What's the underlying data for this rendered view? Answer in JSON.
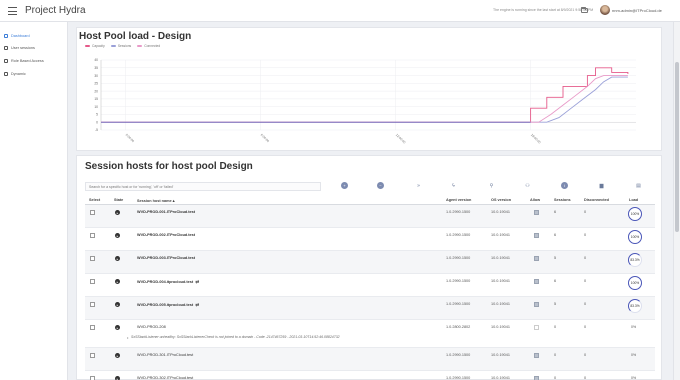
{
  "app": {
    "title": "Project Hydra"
  },
  "topbar": {
    "notice": "The engine is running since the last start at 8/9/2021 9:58:58 PM",
    "user_email": "nnm-admin@ITProCloud.de"
  },
  "sidebar": {
    "items": [
      {
        "label": "Dashboard",
        "icon": "dashboard-icon",
        "active": true
      },
      {
        "label": "User sessions",
        "icon": "users-icon",
        "active": false
      },
      {
        "label": "Role Based Access",
        "icon": "lock-icon",
        "active": false
      },
      {
        "label": "Dynamic",
        "icon": "dynamic-icon",
        "active": false
      }
    ]
  },
  "chart_section": {
    "title": "Host Pool load - Design",
    "legend": [
      {
        "name": "Capacity",
        "color": "#e55a8a"
      },
      {
        "name": "Sessions",
        "color": "#9aa0d8"
      },
      {
        "name": "Connected",
        "color": "#e89ac8"
      }
    ]
  },
  "chart_data": {
    "type": "line",
    "title": "Host Pool load - Design",
    "xlabel": "",
    "ylabel": "",
    "ylim": [
      -5,
      40
    ],
    "yticks": [
      -5,
      0,
      5,
      10,
      15,
      20,
      25,
      30,
      35,
      40
    ],
    "xticks": [
      "0:00:00",
      "6:00:00",
      "12:00:00",
      "18:00:00"
    ],
    "grid": true,
    "series": [
      {
        "name": "Capacity",
        "color": "#e55a8a",
        "points": [
          [
            -0.06,
            0
          ],
          [
            1.0,
            0
          ],
          [
            1.0,
            9
          ],
          [
            1.04,
            9
          ],
          [
            1.04,
            16
          ],
          [
            1.08,
            16
          ],
          [
            1.08,
            23
          ],
          [
            1.14,
            23
          ],
          [
            1.14,
            30
          ],
          [
            1.16,
            30
          ],
          [
            1.16,
            35
          ],
          [
            1.2,
            35
          ],
          [
            1.2,
            32
          ],
          [
            1.24,
            32
          ],
          [
            1.24,
            31
          ]
        ]
      },
      {
        "name": "Sessions",
        "color": "#9aa0d8",
        "points": [
          [
            -0.06,
            0
          ],
          [
            1.04,
            0
          ],
          [
            1.07,
            3
          ],
          [
            1.1,
            9
          ],
          [
            1.13,
            15
          ],
          [
            1.16,
            21
          ],
          [
            1.18,
            26
          ],
          [
            1.2,
            29
          ],
          [
            1.24,
            29
          ]
        ]
      },
      {
        "name": "Connected",
        "color": "#e89ac8",
        "points": [
          [
            -0.06,
            0
          ],
          [
            1.02,
            0
          ],
          [
            1.05,
            5
          ],
          [
            1.08,
            11
          ],
          [
            1.11,
            17
          ],
          [
            1.14,
            23
          ],
          [
            1.16,
            28
          ],
          [
            1.18,
            30
          ],
          [
            1.24,
            30
          ]
        ]
      }
    ],
    "x_domain": [
      -0.06,
      1.26
    ]
  },
  "hosts_section": {
    "title": "Session hosts for host pool Design",
    "search_placeholder": "Search for a specific host or for 'running', 'off' or 'failed'",
    "actions": [
      {
        "name": "add-host-action",
        "glyph": "+",
        "circle": true
      },
      {
        "name": "remove-host-action",
        "glyph": "−",
        "circle": true
      },
      {
        "name": "forward-action",
        "glyph": "»",
        "circle": false
      },
      {
        "name": "power-action",
        "glyph": "ϟ",
        "circle": false
      },
      {
        "name": "attach-action",
        "glyph": "⚲",
        "circle": false
      },
      {
        "name": "assign-user-action",
        "glyph": "⚇",
        "circle": false
      },
      {
        "name": "info-action",
        "glyph": "i",
        "circle": true
      },
      {
        "name": "delete-action",
        "glyph": "▆",
        "circle": false
      },
      {
        "name": "more-action",
        "glyph": "▤",
        "circle": false
      }
    ],
    "columns": {
      "select": "Select",
      "state": "State",
      "name": "Session host name ▴",
      "agent": "Agent version",
      "os": "OS version",
      "allow": "Allow",
      "sessions": "Sessions",
      "disconnected": "Disconnected",
      "load": "Load"
    },
    "rows": [
      {
        "name": "WVD-PROD-001.ITProCloud.test",
        "bold": true,
        "sync": false,
        "agent": "1.0.2990.1500",
        "os": "10.0.19041",
        "allow": true,
        "sessions": "6",
        "disconnected": "0",
        "load": "100%",
        "load_fraction": 1.0,
        "ring": true,
        "error": ""
      },
      {
        "name": "WVD-PROD-002.ITProCloud.test",
        "bold": true,
        "sync": false,
        "agent": "1.0.2990.1500",
        "os": "10.0.19041",
        "allow": true,
        "sessions": "6",
        "disconnected": "0",
        "load": "100%",
        "load_fraction": 1.0,
        "ring": true,
        "error": ""
      },
      {
        "name": "WVD-PROD-003.ITProCloud.test",
        "bold": true,
        "sync": false,
        "agent": "1.0.2990.1500",
        "os": "10.0.19041",
        "allow": true,
        "sessions": "5",
        "disconnected": "0",
        "load": "83.3%",
        "load_fraction": 0.833,
        "ring": true,
        "error": ""
      },
      {
        "name": "WVD-PROD-004.itprocloud.test",
        "bold": true,
        "sync": true,
        "agent": "1.0.2990.1500",
        "os": "10.0.19041",
        "allow": true,
        "sessions": "6",
        "disconnected": "0",
        "load": "100%",
        "load_fraction": 1.0,
        "ring": true,
        "error": ""
      },
      {
        "name": "WVD-PROD-005.itprocloud.test",
        "bold": true,
        "sync": true,
        "agent": "1.0.2990.1500",
        "os": "10.0.19041",
        "allow": true,
        "sessions": "5",
        "disconnected": "0",
        "load": "83.3%",
        "load_fraction": 0.833,
        "ring": true,
        "error": ""
      },
      {
        "name": "WVD-PROD-208",
        "bold": false,
        "sync": false,
        "agent": "1.0.2800.2802",
        "os": "10.0.19041",
        "allow": false,
        "sessions": "0",
        "disconnected": "0",
        "load": "0%",
        "load_fraction": 0,
        "ring": false,
        "error": "SxSStackListenerCheck is not joined to a domain - Code -2147467259 - 2021-03-10T14:52:46.08824732"
      },
      {
        "name": "WVD-PROD-301.ITProCloud.test",
        "bold": false,
        "sync": false,
        "agent": "1.0.2990.1500",
        "os": "10.0.19041",
        "allow": true,
        "sessions": "0",
        "disconnected": "0",
        "load": "0%",
        "load_fraction": 0,
        "ring": false,
        "error": ""
      },
      {
        "name": "WVD-PROD-302.ITProCloud.test",
        "bold": false,
        "sync": false,
        "agent": "1.0.2990.1500",
        "os": "10.0.19041",
        "allow": true,
        "sessions": "0",
        "disconnected": "0",
        "load": "0%",
        "load_fraction": 0,
        "ring": false,
        "error": ""
      }
    ],
    "error_prefix": "SxSStackListener unhealthy:"
  }
}
